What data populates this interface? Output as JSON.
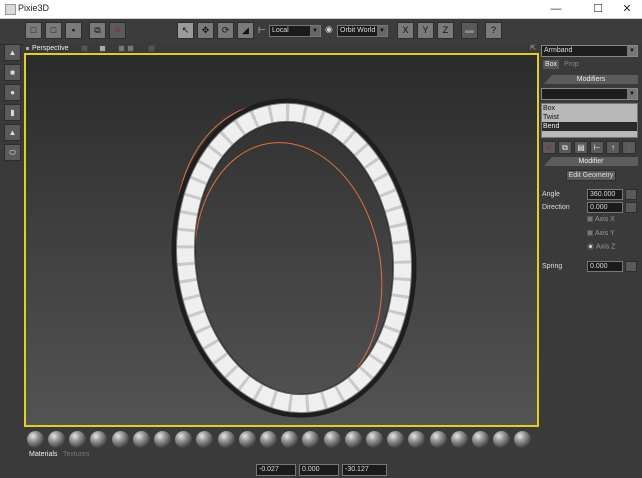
{
  "window": {
    "title": "Pixie3D",
    "minimize_glyph": "—",
    "maximize_glyph": "☐",
    "close_glyph": "✕"
  },
  "toolbar": {
    "coord_space": "Local",
    "orbit_mode": "Orbit World",
    "axis_x": "X",
    "axis_y": "Y",
    "axis_z": "Z",
    "help_glyph": "?"
  },
  "viewport": {
    "label": "Perspective",
    "colors": {
      "border": "#e0d020",
      "wire": "#e07040",
      "mesh": "#cfcfcf"
    }
  },
  "object_panel": {
    "object_name": "Armband",
    "tabs": [
      "Box",
      "Prop"
    ],
    "modifiers_header": "Modifiers",
    "add_modifier_value": "",
    "modifier_stack": [
      {
        "label": "Box",
        "selected": false
      },
      {
        "label": "Twist",
        "selected": false
      },
      {
        "label": "Bend",
        "selected": true
      }
    ],
    "modifier_header": "Modifier",
    "edit_geometry_label": "Edit Geometry",
    "angle_label": "Angle",
    "angle_value": "360.000",
    "direction_label": "Direction",
    "direction_value": "0.000",
    "axis_x_label": "Axis X",
    "axis_y_label": "Axis Y",
    "axis_z_label": "Axis Z",
    "spring_label": "Spring",
    "spring_value": "0.000"
  },
  "material_tabs": [
    "Materials",
    "Textures"
  ],
  "status": {
    "x": "-0.027",
    "y": "0.000",
    "z": "-30.127"
  }
}
